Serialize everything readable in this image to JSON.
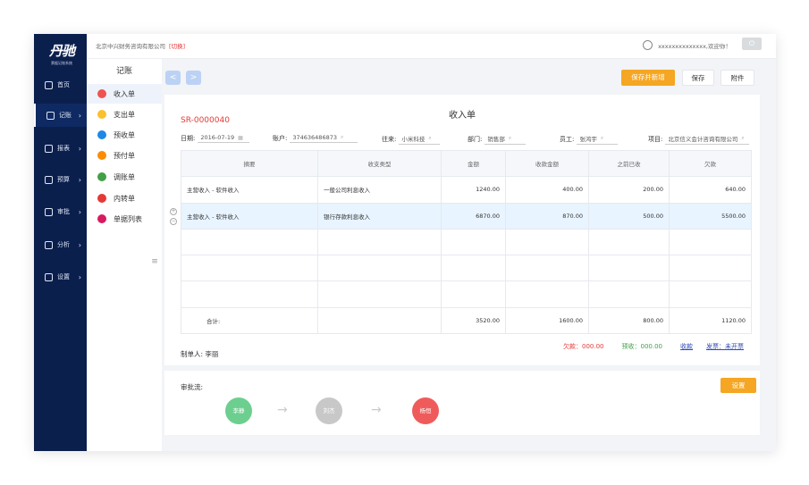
{
  "brand": {
    "logo": "丹驰",
    "subtitle": "票据记账系统"
  },
  "topbar": {
    "company": "北京中兴财务咨询有限公司",
    "switch": "[切换]",
    "welcome": "xxxxxxxxxxxxxx,欢迎你！",
    "power": "⏻"
  },
  "nav": [
    {
      "label": "首页",
      "name": "nav-home"
    },
    {
      "label": "记账",
      "name": "nav-bookkeeping"
    },
    {
      "label": "报表",
      "name": "nav-reports"
    },
    {
      "label": "预算",
      "name": "nav-budget"
    },
    {
      "label": "审批",
      "name": "nav-approval"
    },
    {
      "label": "分析",
      "name": "nav-analysis"
    },
    {
      "label": "设置",
      "name": "nav-settings"
    }
  ],
  "submenu": {
    "title": "记账",
    "items": [
      {
        "label": "收入单",
        "color": "#ef5350"
      },
      {
        "label": "支出单",
        "color": "#fbc02d"
      },
      {
        "label": "预收单",
        "color": "#1e88e5"
      },
      {
        "label": "预付单",
        "color": "#fb8c00"
      },
      {
        "label": "调账单",
        "color": "#43a047"
      },
      {
        "label": "内转单",
        "color": "#e53935"
      },
      {
        "label": "单据列表",
        "color": "#d81b60"
      }
    ]
  },
  "toolbar": {
    "prev": "<",
    "next": ">",
    "save_new": "保存并新增",
    "save": "保存",
    "attach": "附件"
  },
  "doc": {
    "title": "收入单",
    "number": "SR-0000040",
    "fields": {
      "date": {
        "label": "日期:",
        "value": "2016-07-19"
      },
      "account": {
        "label": "账户:",
        "value": "374636486873"
      },
      "party": {
        "label": "往来:",
        "value": "小米科技"
      },
      "dept": {
        "label": "部门:",
        "value": "销售部"
      },
      "staff": {
        "label": "员工:",
        "value": "张鸿宇"
      },
      "project": {
        "label": "项目:",
        "value": "北京信义会计咨询有限公司"
      }
    },
    "columns": [
      "摘要",
      "收支类型",
      "金额",
      "收款金额",
      "之前已收",
      "欠款"
    ],
    "rows": [
      [
        "主营收入 - 软件收入",
        "一般公司利息收入",
        "1240.00",
        "400.00",
        "200.00",
        "640.00"
      ],
      [
        "主营收入 - 软件收入",
        "银行存款利息收入",
        "6870.00",
        "870.00",
        "500.00",
        "5500.00"
      ],
      [
        "",
        "",
        "",
        "",
        "",
        ""
      ],
      [
        "",
        "",
        "",
        "",
        "",
        ""
      ],
      [
        "",
        "",
        "",
        "",
        "",
        ""
      ]
    ],
    "total": {
      "label": "合计:",
      "amount": "3520.00",
      "received": "1600.00",
      "before": "800.00",
      "owed": "1120.00"
    },
    "summary": {
      "owed": "欠款：000.00",
      "prepaid": "预收：000.00",
      "collect": "收款",
      "invoice": "发票：未开票"
    },
    "maker": "制单人: 李丽"
  },
  "approval": {
    "label": "审批流:",
    "set": "设置",
    "nodes": [
      {
        "name": "李静",
        "color": "#6ccf8f"
      },
      {
        "name": "刘杰",
        "color": "#c8c8c8"
      },
      {
        "name": "杨恒",
        "color": "#ef5b5b"
      }
    ],
    "arrow": "→"
  }
}
